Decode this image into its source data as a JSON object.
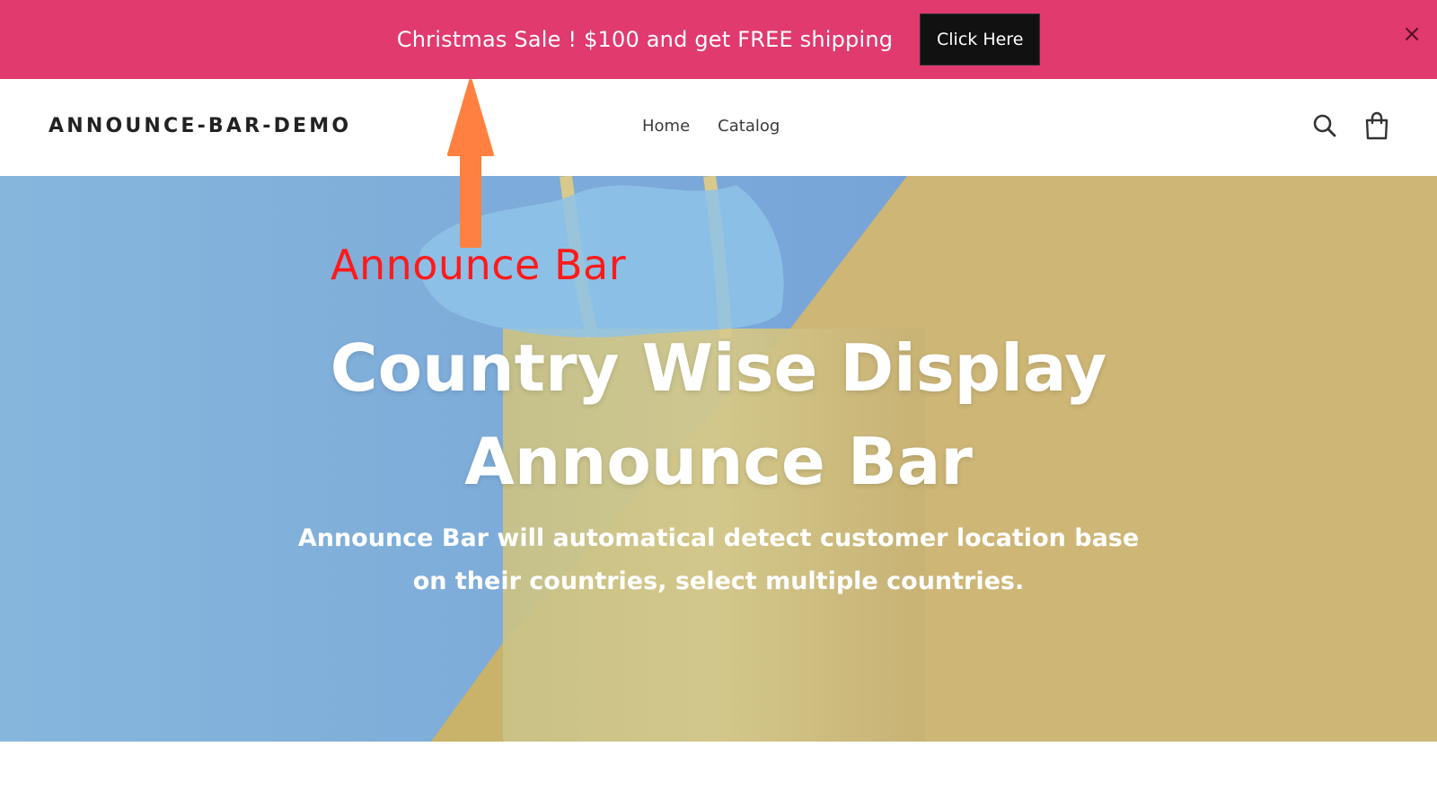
{
  "announcement": {
    "message": "Christmas Sale ! $100 and get FREE shipping",
    "cta_label": "Click Here",
    "close_glyph": "×",
    "background_color": "#e03a6f"
  },
  "header": {
    "logo": "ANNOUNCE-BAR-DEMO",
    "nav": [
      {
        "label": "Home"
      },
      {
        "label": "Catalog"
      }
    ],
    "icons": [
      "search-icon",
      "cart-icon"
    ]
  },
  "hero": {
    "title": "Country Wise Display Announce Bar",
    "subtitle": "Announce Bar will automatical detect customer location base on their countries, select multiple countries."
  },
  "annotation": {
    "label": "Announce Bar",
    "arrow_color": "#ff8040",
    "label_color": "#ff1a1a"
  }
}
